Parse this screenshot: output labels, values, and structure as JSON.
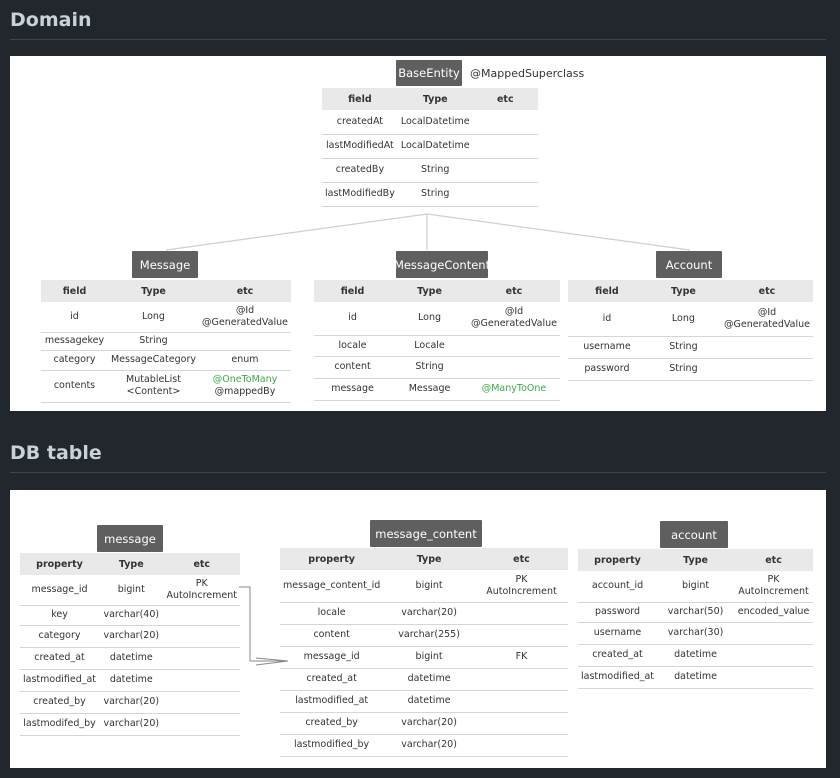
{
  "sections": {
    "domain": "Domain",
    "db": "DB table"
  },
  "domain": {
    "base": {
      "name": "BaseEntity",
      "annotation": "@MappedSuperclass",
      "headers": [
        "field",
        "Type",
        "etc"
      ],
      "rows": [
        [
          "createdAt",
          "LocalDatetime",
          ""
        ],
        [
          "lastModifiedAt",
          "LocalDatetime",
          ""
        ],
        [
          "createdBy",
          "String",
          ""
        ],
        [
          "lastModifiedBy",
          "String",
          ""
        ]
      ]
    },
    "message": {
      "name": "Message",
      "headers": [
        "field",
        "Type",
        "etc"
      ],
      "rows": [
        [
          "id",
          "Long",
          "@Id\n@GeneratedValue"
        ],
        [
          "messagekey",
          "String",
          ""
        ],
        [
          "category",
          "MessageCategory",
          "enum"
        ],
        [
          "contents",
          "MutableList\n<Content>",
          "@OneToMany\n@mappedBy"
        ]
      ]
    },
    "message_content": {
      "name": "MessageContent",
      "headers": [
        "field",
        "Type",
        "etc"
      ],
      "rows": [
        [
          "id",
          "Long",
          "@Id\n@GeneratedValue"
        ],
        [
          "locale",
          "Locale",
          ""
        ],
        [
          "content",
          "String",
          ""
        ],
        [
          "message",
          "Message",
          "@ManyToOne"
        ]
      ]
    },
    "account": {
      "name": "Account",
      "headers": [
        "field",
        "Type",
        "etc"
      ],
      "rows": [
        [
          "id",
          "Long",
          "@Id\n@GeneratedValue"
        ],
        [
          "username",
          "String",
          ""
        ],
        [
          "password",
          "String",
          ""
        ]
      ]
    }
  },
  "db": {
    "message": {
      "name": "message",
      "headers": [
        "property",
        "Type",
        "etc"
      ],
      "rows": [
        [
          "message_id",
          "bigint",
          "PK\nAutoIncrement"
        ],
        [
          "key",
          "varchar(40)",
          ""
        ],
        [
          "category",
          "varchar(20)",
          ""
        ],
        [
          "created_at",
          "datetime",
          ""
        ],
        [
          "lastmodified_at",
          "datetime",
          ""
        ],
        [
          "created_by",
          "varchar(20)",
          ""
        ],
        [
          "lastmodifed_by",
          "varchar(20)",
          ""
        ]
      ]
    },
    "message_content": {
      "name": "message_content",
      "headers": [
        "property",
        "Type",
        "etc"
      ],
      "rows": [
        [
          "message_content_id",
          "bigint",
          "PK\nAutoIncrement"
        ],
        [
          "locale",
          "varchar(20)",
          ""
        ],
        [
          "content",
          "varchar(255)",
          ""
        ],
        [
          "message_id",
          "bigint",
          "FK"
        ],
        [
          "created_at",
          "datetime",
          ""
        ],
        [
          "lastmodified_at",
          "datetime",
          ""
        ],
        [
          "created_by",
          "varchar(20)",
          ""
        ],
        [
          "lastmodified_by",
          "varchar(20)",
          ""
        ]
      ]
    },
    "account": {
      "name": "account",
      "headers": [
        "property",
        "Type",
        "etc"
      ],
      "rows": [
        [
          "account_id",
          "bigint",
          "PK\nAutoIncrement"
        ],
        [
          "password",
          "varchar(50)",
          "encoded_value"
        ],
        [
          "username",
          "varchar(30)",
          ""
        ],
        [
          "created_at",
          "datetime",
          ""
        ],
        [
          "lastmodified_at",
          "datetime",
          ""
        ]
      ]
    }
  }
}
